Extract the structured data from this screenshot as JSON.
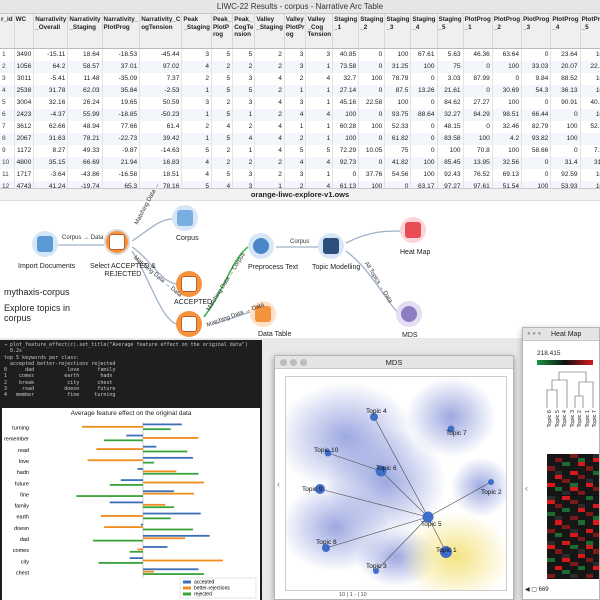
{
  "table_window": {
    "title": "LIWC-22 Results - corpus - Narrative Arc Table",
    "headers": [
      "r_id",
      "WC",
      "Narrativity _Overall",
      "Narrativity _Staging",
      "Narrativity_ PlotProg",
      "Narrativity_C ogTension",
      "Peak _Staging",
      "Peak_ PlotP rog",
      "Peak_ CogTe nsion",
      "Valley _Staging",
      "Valley PlotPr og",
      "Valley _Cog Tension",
      "Staging _1",
      "Staging _2",
      "Staging _3",
      "Staging _4",
      "Staging _5",
      "PlotProg _1",
      "PlotProg _2",
      "PlotProg _3",
      "PlotProg _4",
      "PlotProg _5"
    ],
    "rows": [
      [
        "1",
        "3490",
        "-15.11",
        "18.64",
        "-18.53",
        "-45.44",
        "3",
        "5",
        "5",
        "2",
        "3",
        "3",
        "40.85",
        "0",
        "100",
        "67.61",
        "5.63",
        "46.36",
        "63.64",
        "0",
        "23.64",
        "100"
      ],
      [
        "2",
        "1056",
        "64.2",
        "58.57",
        "37.01",
        "97.02",
        "4",
        "2",
        "2",
        "2",
        "3",
        "1",
        "73.58",
        "0",
        "31.25",
        "100",
        "75",
        "0",
        "100",
        "33.03",
        "20.07",
        "22.23"
      ],
      [
        "3",
        "3011",
        "-5.41",
        "11.48",
        "-35.09",
        "7.37",
        "2",
        "5",
        "3",
        "4",
        "2",
        "4",
        "32.7",
        "100",
        "78.79",
        "0",
        "3.03",
        "87.99",
        "0",
        "9.84",
        "88.52",
        "100"
      ],
      [
        "4",
        "2538",
        "31.78",
        "62.03",
        "35.84",
        "-2.53",
        "1",
        "5",
        "5",
        "2",
        "1",
        "1",
        "27.14",
        "0",
        "87.5",
        "13.26",
        "21.61",
        "0",
        "30.69",
        "54.3",
        "36.13",
        "100"
      ],
      [
        "5",
        "3004",
        "32.16",
        "26.24",
        "19.65",
        "50.59",
        "3",
        "2",
        "3",
        "4",
        "3",
        "1",
        "45.16",
        "22.58",
        "100",
        "0",
        "84.62",
        "27.27",
        "100",
        "0",
        "90.91",
        "40.35"
      ],
      [
        "6",
        "2423",
        "-4.37",
        "55.99",
        "-18.85",
        "-50.23",
        "1",
        "5",
        "1",
        "2",
        "4",
        "4",
        "100",
        "0",
        "93.75",
        "88.64",
        "32.27",
        "84.29",
        "98.51",
        "66.44",
        "0",
        "100"
      ],
      [
        "7",
        "3612",
        "62.66",
        "48.94",
        "77.66",
        "61.4",
        "2",
        "4",
        "2",
        "4",
        "1",
        "1",
        "60.28",
        "100",
        "52.33",
        "0",
        "48.15",
        "0",
        "32.46",
        "82.79",
        "100",
        "52.19"
      ],
      [
        "8",
        "2067",
        "31.63",
        "78.21",
        "-22.73",
        "39.42",
        "1",
        "5",
        "4",
        "4",
        "2",
        "1",
        "100",
        "0",
        "61.82",
        "0",
        "83.58",
        "100",
        "4.2",
        "93.82",
        "100",
        "0"
      ],
      [
        "9",
        "1172",
        "8.27",
        "49.33",
        "-9.87",
        "-14.63",
        "5",
        "2",
        "1",
        "4",
        "5",
        "5",
        "72.29",
        "10.05",
        "75",
        "0",
        "100",
        "70.8",
        "100",
        "58.66",
        "0",
        "7.33"
      ],
      [
        "10",
        "4800",
        "35.15",
        "66.69",
        "21.94",
        "16.83",
        "4",
        "2",
        "2",
        "2",
        "4",
        "4",
        "92.73",
        "0",
        "41.82",
        "100",
        "85.45",
        "13.95",
        "32.56",
        "0",
        "31.4",
        "31.4"
      ],
      [
        "11",
        "1717",
        "-3.64",
        "-43.86",
        "-16.58",
        "18.51",
        "4",
        "5",
        "3",
        "2",
        "3",
        "1",
        "0",
        "37.76",
        "54.56",
        "100",
        "92.43",
        "76.52",
        "69.13",
        "0",
        "92.59",
        "100"
      ],
      [
        "12",
        "4743",
        "41.24",
        "-19.74",
        "65.3",
        "78.16",
        "5",
        "4",
        "3",
        "1",
        "2",
        "4",
        "61.13",
        "100",
        "0",
        "63.17",
        "97.27",
        "97.61",
        "51.54",
        "100",
        "53.93",
        "100"
      ]
    ]
  },
  "workflow": {
    "title": "orange-liwc-explore-v1.ows",
    "nodes": {
      "import": "Import Documents",
      "select": "Select ACCEPTED &\nREJECTED",
      "corpus": "Corpus",
      "accepted": "ACCEPTED",
      "rejected": "REJECTED",
      "datatable": "Data Table",
      "preprocess": "Preprocess Text",
      "topic": "Topic Modelling",
      "heatmap": "Heat Map",
      "mds": "MDS"
    },
    "edges": {
      "e1": "Corpus → Data",
      "e2": "Matching Data →",
      "e3": "Matching Data → Data",
      "e4": "Matching Data → Corpus",
      "e5": "Corpus",
      "e6": "All Topics → Data",
      "e7": "Matching Data → Data"
    },
    "note_title": "mythaxis-corpus",
    "note_body": "Explore topics in corpus",
    "colors": {
      "orange": "#f5923e",
      "blue": "#5b9bd5",
      "lightblue": "#d6e6f6",
      "red": "#e84d56",
      "purple": "#8e7cc3"
    }
  },
  "notebook": {
    "code_lines": [
      "→ plot_feature_effect(c).set_title(\"Average feature effect on the original data\")",
      "  0.2s",
      "top 5 keywords per class:",
      "  accepted better-rejections rejected",
      "0      dad           love      family",
      "1    comes          earth       hadn",
      "2    break           city      chest",
      "3     road          doesn      future",
      "4   member           fine     turning"
    ],
    "chart_data": {
      "type": "bar",
      "title": "Average feature effect on the original data",
      "categories": [
        "turning",
        "remember",
        "read",
        "love",
        "hadn",
        "future",
        "fine",
        "family",
        "earth",
        "doesn",
        "dad",
        "comes",
        "city",
        "chest"
      ],
      "series": [
        {
          "name": "accepted",
          "color": "#3b6fb6",
          "values": [
            0.35,
            -0.15,
            0.12,
            0.45,
            -0.05,
            -0.2,
            0.28,
            -0.3,
            0.52,
            -0.02,
            0.6,
            0.22,
            -0.12,
            0.5
          ]
        },
        {
          "name": "better-rejections",
          "color": "#f08c1e",
          "values": [
            -0.55,
            0.5,
            -0.42,
            -0.5,
            0.3,
            0.55,
            0.46,
            0.2,
            -0.38,
            -0.35,
            0.38,
            -0.05,
            0.72,
            0.1
          ]
        },
        {
          "name": "rejected",
          "color": "#3aa23a",
          "values": [
            0.25,
            -0.35,
            0.4,
            0.1,
            0.5,
            -0.3,
            -0.6,
            0.28,
            0.25,
            0.45,
            -0.45,
            -0.12,
            -0.4,
            0.55
          ]
        }
      ]
    }
  },
  "mds_window": {
    "title": "MDS",
    "topics": [
      "Topic 1",
      "Topic 2",
      "Topic 3",
      "Topic 4",
      "Topic 5",
      "Topic 6",
      "Topic 7",
      "Topic 8",
      "Topic 9",
      "Topic 10"
    ],
    "status": "10 | 1 -  | 10"
  },
  "heatmap_window": {
    "title": "Heat Map",
    "scale_min": "218.415",
    "scale_max": "0",
    "rows": [
      "Topic 6",
      "Topic 5",
      "Topic 4",
      "Topic 3",
      "Topic 2",
      "Topic 1",
      "Topic 7"
    ],
    "status": "669"
  }
}
